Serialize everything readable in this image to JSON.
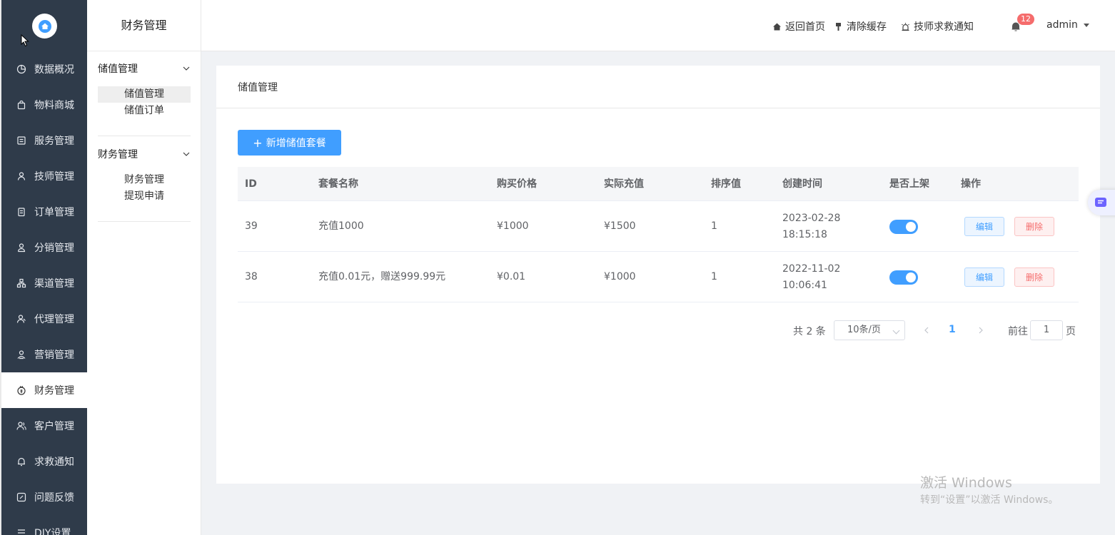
{
  "nav": {
    "items": [
      {
        "label": "数据概况",
        "icon": "pie-chart-icon"
      },
      {
        "label": "物料商城",
        "icon": "shopping-bag-icon"
      },
      {
        "label": "服务管理",
        "icon": "service-icon"
      },
      {
        "label": "技师管理",
        "icon": "technician-icon"
      },
      {
        "label": "订单管理",
        "icon": "order-icon"
      },
      {
        "label": "分销管理",
        "icon": "distribution-icon"
      },
      {
        "label": "渠道管理",
        "icon": "channel-icon"
      },
      {
        "label": "代理管理",
        "icon": "agent-icon"
      },
      {
        "label": "营销管理",
        "icon": "marketing-icon"
      },
      {
        "label": "财务管理",
        "icon": "finance-icon",
        "active": true
      },
      {
        "label": "客户管理",
        "icon": "customer-icon"
      },
      {
        "label": "求救通知",
        "icon": "bell-icon"
      },
      {
        "label": "问题反馈",
        "icon": "feedback-icon"
      },
      {
        "label": "DIY设置",
        "icon": "diy-icon"
      }
    ]
  },
  "subnav": {
    "title": "财务管理",
    "groups": [
      {
        "title": "储值管理",
        "links": [
          "储值管理",
          "储值订单"
        ],
        "active_index": 0
      },
      {
        "title": "财务管理",
        "links": [
          "财务管理",
          "提现申请"
        ]
      }
    ]
  },
  "header": {
    "home": "返回首页",
    "clear_cache": "清除缓存",
    "tech_alert": "技师求救通知",
    "notif_count": "12",
    "user": "admin"
  },
  "card": {
    "title": "储值管理",
    "add_button": "新增储值套餐"
  },
  "table": {
    "columns": [
      "ID",
      "套餐名称",
      "购买价格",
      "实际充值",
      "排序值",
      "创建时间",
      "是否上架",
      "操作"
    ],
    "rows": [
      {
        "id": "39",
        "name": "充值1000",
        "price": "¥1000",
        "actual": "¥1500",
        "sort": "1",
        "date": "2023-02-28",
        "time": "18:15:18",
        "on_shelf": true,
        "edit": "编辑",
        "delete": "删除"
      },
      {
        "id": "38",
        "name": "充值0.01元，赠送999.99元",
        "price": "¥0.01",
        "actual": "¥1000",
        "sort": "1",
        "date": "2022-11-02",
        "time": "10:06:41",
        "on_shelf": true,
        "edit": "编辑",
        "delete": "删除"
      }
    ]
  },
  "pagination": {
    "total": "共 2 条",
    "page_size": "10条/页",
    "current": "1",
    "goto_label": "前往",
    "goto_value": "1",
    "page_suffix": "页"
  },
  "watermark": {
    "line1": "激活 Windows",
    "line2": "转到“设置”以激活 Windows。"
  },
  "colors": {
    "nav_bg": "#2f3b4a",
    "primary": "#409eff",
    "danger": "#f56c6c"
  }
}
